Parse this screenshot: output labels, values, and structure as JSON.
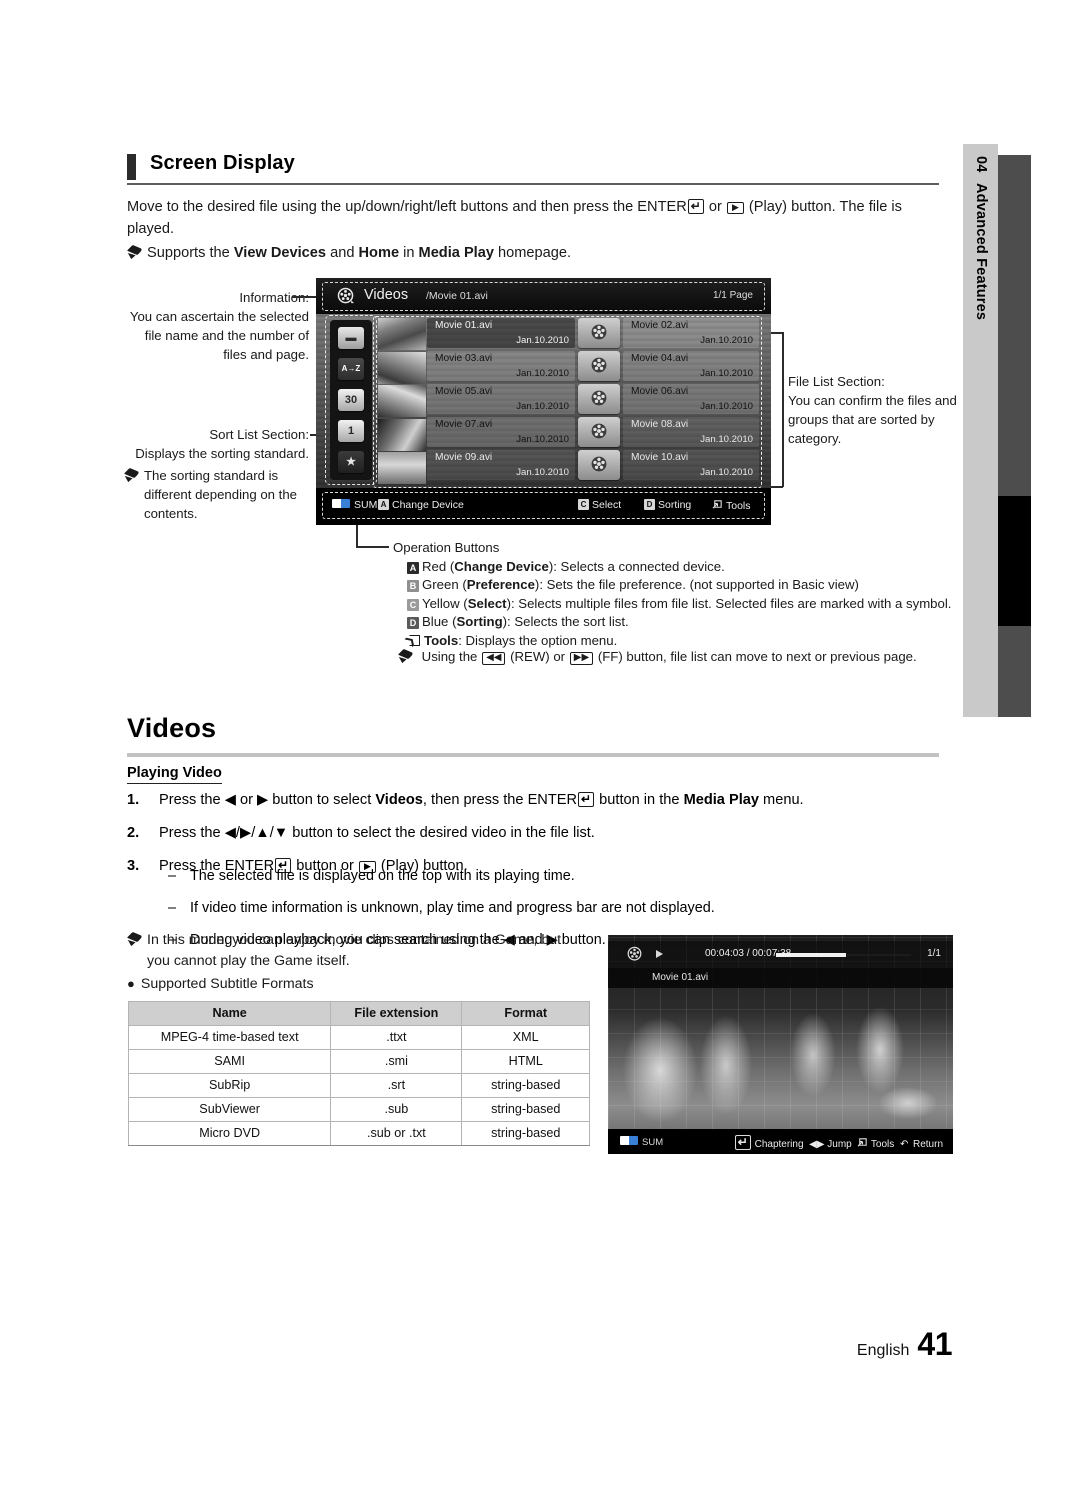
{
  "sidebar": {
    "number": "04",
    "label": "Advanced Features"
  },
  "footer": {
    "language": "English",
    "page_number": "41"
  },
  "screen_display": {
    "heading": "Screen Display",
    "intro_1": "Move to the desired file using the up/down/right/left buttons and then press the ENTER",
    "intro_2": "or",
    "intro_3": "(Play) button. The file is played.",
    "note_1_a": "Supports the ",
    "note_1_b": "View Devices",
    "note_1_c": " and ",
    "note_1_d": "Home",
    "note_1_e": " in ",
    "note_1_f": "Media Play",
    "note_1_g": " homepage."
  },
  "callouts": {
    "information_title": "Information:",
    "information_body": "You can ascertain the selected file name and the number of files and page.",
    "sort_title": "Sort List Section:",
    "sort_body": "Displays the sorting standard.",
    "sort_note": "The sorting standard is different depending on the contents.",
    "filelist_title": "File List Section:",
    "filelist_body": "You can confirm the files and groups that are sorted by category."
  },
  "tv_ui": {
    "header": {
      "icon": "film-reel-icon",
      "title": "Videos",
      "path": "/Movie 01.avi",
      "page": "1/1 Page"
    },
    "sort_icons": [
      {
        "name": "folder-icon",
        "glyph": "▬"
      },
      {
        "name": "alphabetical-sort-icon",
        "glyph": "A→Z"
      },
      {
        "name": "calendar-month-icon",
        "glyph": "30"
      },
      {
        "name": "calendar-day-icon",
        "glyph": "1"
      },
      {
        "name": "favorite-star-icon",
        "glyph": "★"
      }
    ],
    "files": [
      {
        "name": "Movie 01.avi",
        "date": "Jan.10.2010",
        "selected": true
      },
      {
        "name": "Movie 02.avi",
        "date": "Jan.10.2010",
        "selected": false
      },
      {
        "name": "Movie 03.avi",
        "date": "Jan.10.2010",
        "selected": false
      },
      {
        "name": "Movie 04.avi",
        "date": "Jan.10.2010",
        "selected": false
      },
      {
        "name": "Movie 05.avi",
        "date": "Jan.10.2010",
        "selected": false
      },
      {
        "name": "Movie 06.avi",
        "date": "Jan.10.2010",
        "selected": false
      },
      {
        "name": "Movie 07.avi",
        "date": "Jan.10.2010",
        "selected": false
      },
      {
        "name": "Movie 08.avi",
        "date": "Jan.10.2010",
        "selected": false
      },
      {
        "name": "Movie 09.avi",
        "date": "Jan.10.2010",
        "selected": false
      },
      {
        "name": "Movie 10.avi",
        "date": "Jan.10.2010",
        "selected": false
      }
    ],
    "opbar": {
      "sum": "SUM",
      "change_device_key": "A",
      "change_device": "Change Device",
      "select_key": "C",
      "select": "Select",
      "sorting_key": "D",
      "sorting": "Sorting",
      "tools": "Tools"
    }
  },
  "operation_buttons": {
    "title": "Operation Buttons",
    "rows": [
      {
        "key": "A",
        "color": "Red",
        "name": "Change Device",
        "desc": ": Selects a connected device."
      },
      {
        "key": "B",
        "color": "Green",
        "name": "Preference",
        "desc": ": Sets the file preference. (not supported in Basic view)"
      },
      {
        "key": "C",
        "color": "Yellow",
        "name": "Select",
        "desc": ": Selects multiple files from file list. Selected files are marked with a symbol."
      },
      {
        "key": "D",
        "color": "Blue",
        "name": "Sorting",
        "desc": ": Selects the sort list."
      }
    ],
    "tools_label": "Tools",
    "tools_desc": ": Displays the option menu.",
    "rew_note_1": "Using the",
    "rew_note_2": "(REW) or",
    "rew_note_3": "(FF) button, file list can move to next or previous page."
  },
  "videos": {
    "heading": "Videos",
    "subheading": "Playing Video",
    "steps": [
      {
        "n": "1.",
        "a": "Press the ◀ or ▶ button to select ",
        "b": "Videos",
        "c": ", then press the ENTER",
        "d": " button in the ",
        "e": "Media Play",
        "f": " menu."
      },
      {
        "n": "2.",
        "a": "Press the ◀/▶/▲/▼ button to select the desired video in the file list.",
        "b": "",
        "c": "",
        "d": "",
        "e": "",
        "f": ""
      },
      {
        "n": "3.",
        "a": "Press the ENTER",
        "b": "",
        "c": "",
        "d": " button or ",
        "e": "",
        "f": " (Play) button."
      }
    ],
    "dashes": [
      "The selected file is displayed on the top with its playing time.",
      "If video time information is unknown, play time and progress bar are not displayed.",
      "During video playback, you can search using the ◀ and ▶ button."
    ],
    "game_note": "In this mode, you can enjoy movie clips contained on a Game, but you cannot play the Game itself.",
    "subtitle_bullet": "Supported Subtitle Formats"
  },
  "subtitle_table": {
    "headers": [
      "Name",
      "File extension",
      "Format"
    ],
    "rows": [
      [
        "MPEG-4 time-based text",
        ".ttxt",
        "XML"
      ],
      [
        "SAMI",
        ".smi",
        "HTML"
      ],
      [
        "SubRip",
        ".srt",
        "string-based"
      ],
      [
        "SubViewer",
        ".sub",
        "string-based"
      ],
      [
        "Micro DVD",
        ".sub or .txt",
        "string-based"
      ]
    ]
  },
  "player": {
    "file_name": "Movie 01.avi",
    "time": "00:04:03 / 00:07:38",
    "page": "1/1",
    "sum": "SUM",
    "chaptering": "Chaptering",
    "jump": "Jump",
    "tools": "Tools",
    "return": "Return"
  },
  "colors": {
    "accent_dark": "#2b2b2b",
    "tab_light": "#c9c9c9",
    "tab_dark": "#4d4d4d",
    "rule": "#9a9a9a"
  }
}
